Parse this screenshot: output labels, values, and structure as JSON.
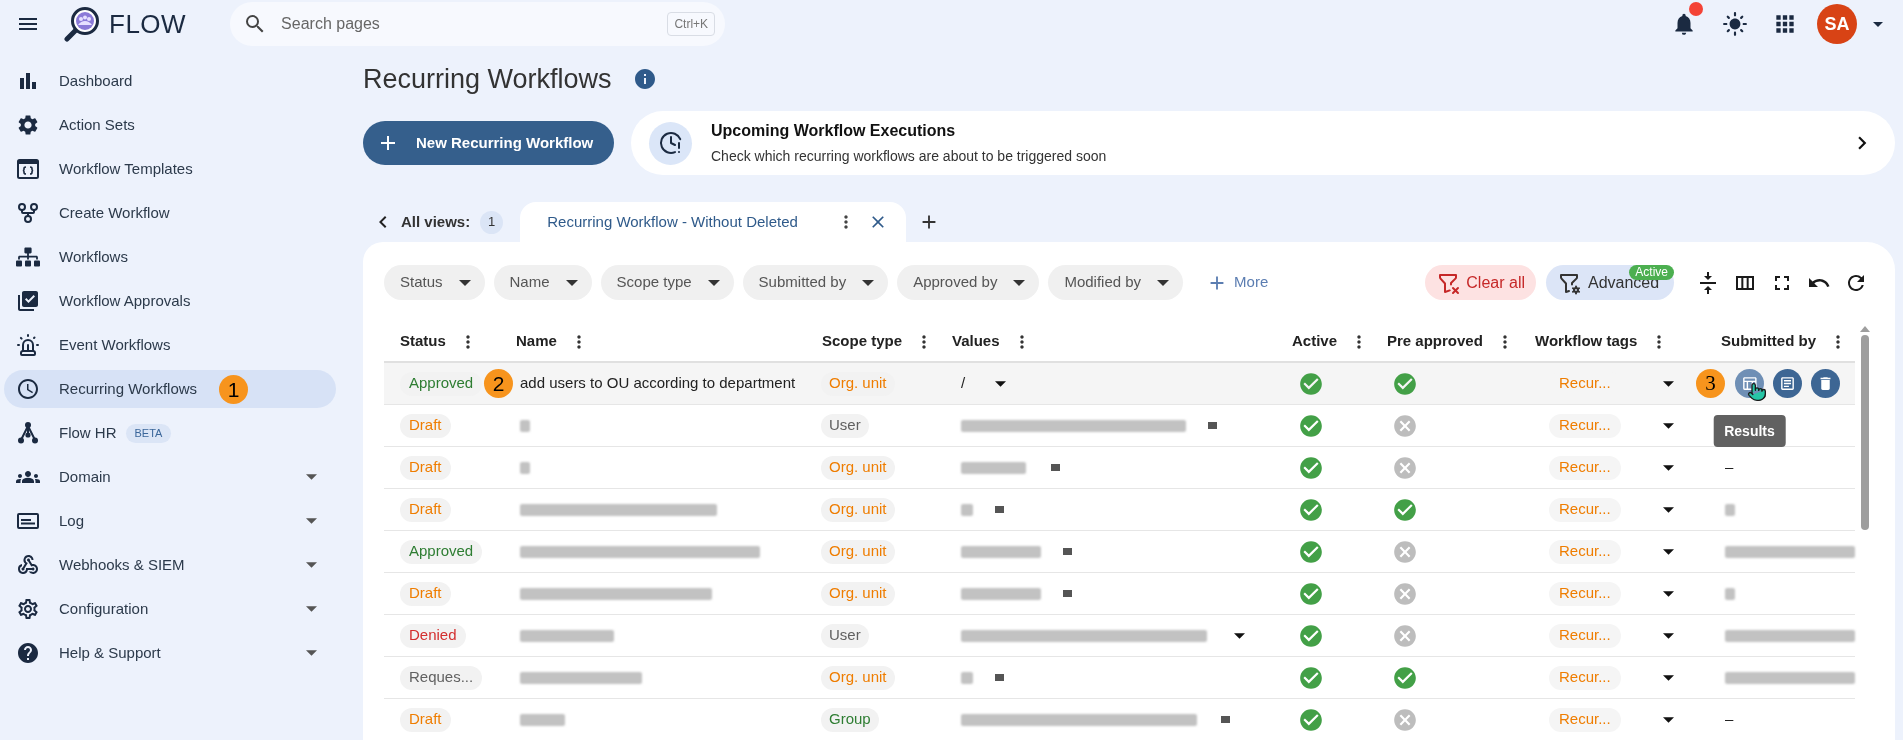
{
  "topbar": {
    "app_name": "FLOW",
    "search": {
      "placeholder": "Search pages",
      "shortcut": "Ctrl+K"
    },
    "notifications": {
      "unread": true
    },
    "avatar": "SA"
  },
  "sidebar": {
    "items": [
      {
        "label": "Dashboard",
        "selected": false
      },
      {
        "label": "Action Sets",
        "selected": false
      },
      {
        "label": "Workflow Templates",
        "selected": false
      },
      {
        "label": "Create Workflow",
        "selected": false
      },
      {
        "label": "Workflows",
        "selected": false
      },
      {
        "label": "Workflow Approvals",
        "selected": false
      },
      {
        "label": "Event Workflows",
        "selected": false
      },
      {
        "label": "Recurring Workflows",
        "selected": true,
        "callout": "1"
      },
      {
        "label": "Flow HR",
        "selected": false,
        "badge": "BETA"
      },
      {
        "label": "Domain",
        "selected": false,
        "expanded": false
      },
      {
        "label": "Log",
        "selected": false,
        "expanded": false
      },
      {
        "label": "Webhooks & SIEM",
        "selected": false,
        "expanded": false
      },
      {
        "label": "Configuration",
        "selected": false,
        "expanded": false
      },
      {
        "label": "Help & Support",
        "selected": false,
        "expanded": false
      }
    ]
  },
  "page": {
    "title": "Recurring Workflows",
    "new_button": "New Recurring Workflow",
    "upcoming_card": {
      "title": "Upcoming Workflow Executions",
      "subtitle": "Check which recurring workflows are about to be triggered soon"
    }
  },
  "views": {
    "label": "All views:",
    "count": "1",
    "tabs": [
      {
        "label": "Recurring Workflow - Without Deleted",
        "selected": true
      }
    ]
  },
  "filters": {
    "chips": [
      "Status",
      "Name",
      "Scope type",
      "Submitted by",
      "Approved by",
      "Modified by"
    ],
    "more": "More",
    "clear_all": "Clear all",
    "advanced": {
      "label": "Advanced",
      "badge": "Active"
    }
  },
  "table": {
    "columns": [
      "Status",
      "Name",
      "Scope type",
      "Values",
      "Active",
      "Pre approved",
      "Workflow tags",
      "Submitted by"
    ],
    "row_actions": {
      "callout": "3",
      "buttons": [
        {
          "kind": "results",
          "tooltip": "Results"
        },
        {
          "kind": "details"
        },
        {
          "kind": "delete"
        }
      ]
    },
    "rows": [
      {
        "highlighted": true,
        "callout": "2",
        "status": {
          "label": "Approved",
          "kind": "approved"
        },
        "name": {
          "kind": "text",
          "text": "add users to OU according to department"
        },
        "scope": {
          "label": "Org. unit",
          "kind": "org_unit"
        },
        "values": {
          "kind": "text",
          "text": "/",
          "dropdown": true
        },
        "active": true,
        "pre_approved": true,
        "tag": "Recur..."
      },
      {
        "highlighted": false,
        "status": {
          "label": "Draft",
          "kind": "draft"
        },
        "name": {
          "kind": "blurred"
        },
        "scope": {
          "label": "User",
          "kind": "user"
        },
        "values": {
          "kind": "blurred",
          "dropdown": false
        },
        "active": true,
        "pre_approved": false,
        "tag": "Recur..."
      },
      {
        "highlighted": false,
        "status": {
          "label": "Draft",
          "kind": "draft"
        },
        "name": {
          "kind": "blurred"
        },
        "scope": {
          "label": "Org. unit",
          "kind": "org_unit"
        },
        "values": {
          "kind": "blurred",
          "dropdown": false
        },
        "active": true,
        "pre_approved": false,
        "tag": "Recur...",
        "submitted_by": {
          "kind": "text",
          "text": "–"
        }
      },
      {
        "highlighted": false,
        "status": {
          "label": "Draft",
          "kind": "draft"
        },
        "name": {
          "kind": "blurred"
        },
        "scope": {
          "label": "Org. unit",
          "kind": "org_unit"
        },
        "values": {
          "kind": "blurred",
          "dropdown": false
        },
        "active": true,
        "pre_approved": true,
        "tag": "Recur...",
        "submitted_by": {
          "kind": "blurred"
        }
      },
      {
        "highlighted": false,
        "status": {
          "label": "Approved",
          "kind": "approved"
        },
        "name": {
          "kind": "blurred"
        },
        "scope": {
          "label": "Org. unit",
          "kind": "org_unit"
        },
        "values": {
          "kind": "blurred",
          "dropdown": false
        },
        "active": true,
        "pre_approved": false,
        "tag": "Recur...",
        "submitted_by": {
          "kind": "blurred"
        }
      },
      {
        "highlighted": false,
        "status": {
          "label": "Draft",
          "kind": "draft"
        },
        "name": {
          "kind": "blurred"
        },
        "scope": {
          "label": "Org. unit",
          "kind": "org_unit"
        },
        "values": {
          "kind": "blurred",
          "dropdown": false
        },
        "active": true,
        "pre_approved": false,
        "tag": "Recur...",
        "submitted_by": {
          "kind": "blurred"
        }
      },
      {
        "highlighted": false,
        "status": {
          "label": "Denied",
          "kind": "denied"
        },
        "name": {
          "kind": "blurred"
        },
        "scope": {
          "label": "User",
          "kind": "user"
        },
        "values": {
          "kind": "blurred",
          "dropdown": true
        },
        "active": true,
        "pre_approved": false,
        "tag": "Recur...",
        "submitted_by": {
          "kind": "blurred"
        }
      },
      {
        "highlighted": false,
        "status": {
          "label": "Reques...",
          "kind": "requested"
        },
        "name": {
          "kind": "blurred"
        },
        "scope": {
          "label": "Org. unit",
          "kind": "org_unit"
        },
        "values": {
          "kind": "blurred",
          "dropdown": false
        },
        "active": true,
        "pre_approved": true,
        "tag": "Recur...",
        "submitted_by": {
          "kind": "blurred"
        }
      },
      {
        "highlighted": false,
        "status": {
          "label": "Draft",
          "kind": "draft"
        },
        "name": {
          "kind": "blurred"
        },
        "scope": {
          "label": "Group",
          "kind": "group"
        },
        "values": {
          "kind": "blurred",
          "dropdown": false
        },
        "active": true,
        "pre_approved": false,
        "tag": "Recur...",
        "submitted_by": {
          "kind": "text",
          "text": "–"
        }
      }
    ]
  }
}
